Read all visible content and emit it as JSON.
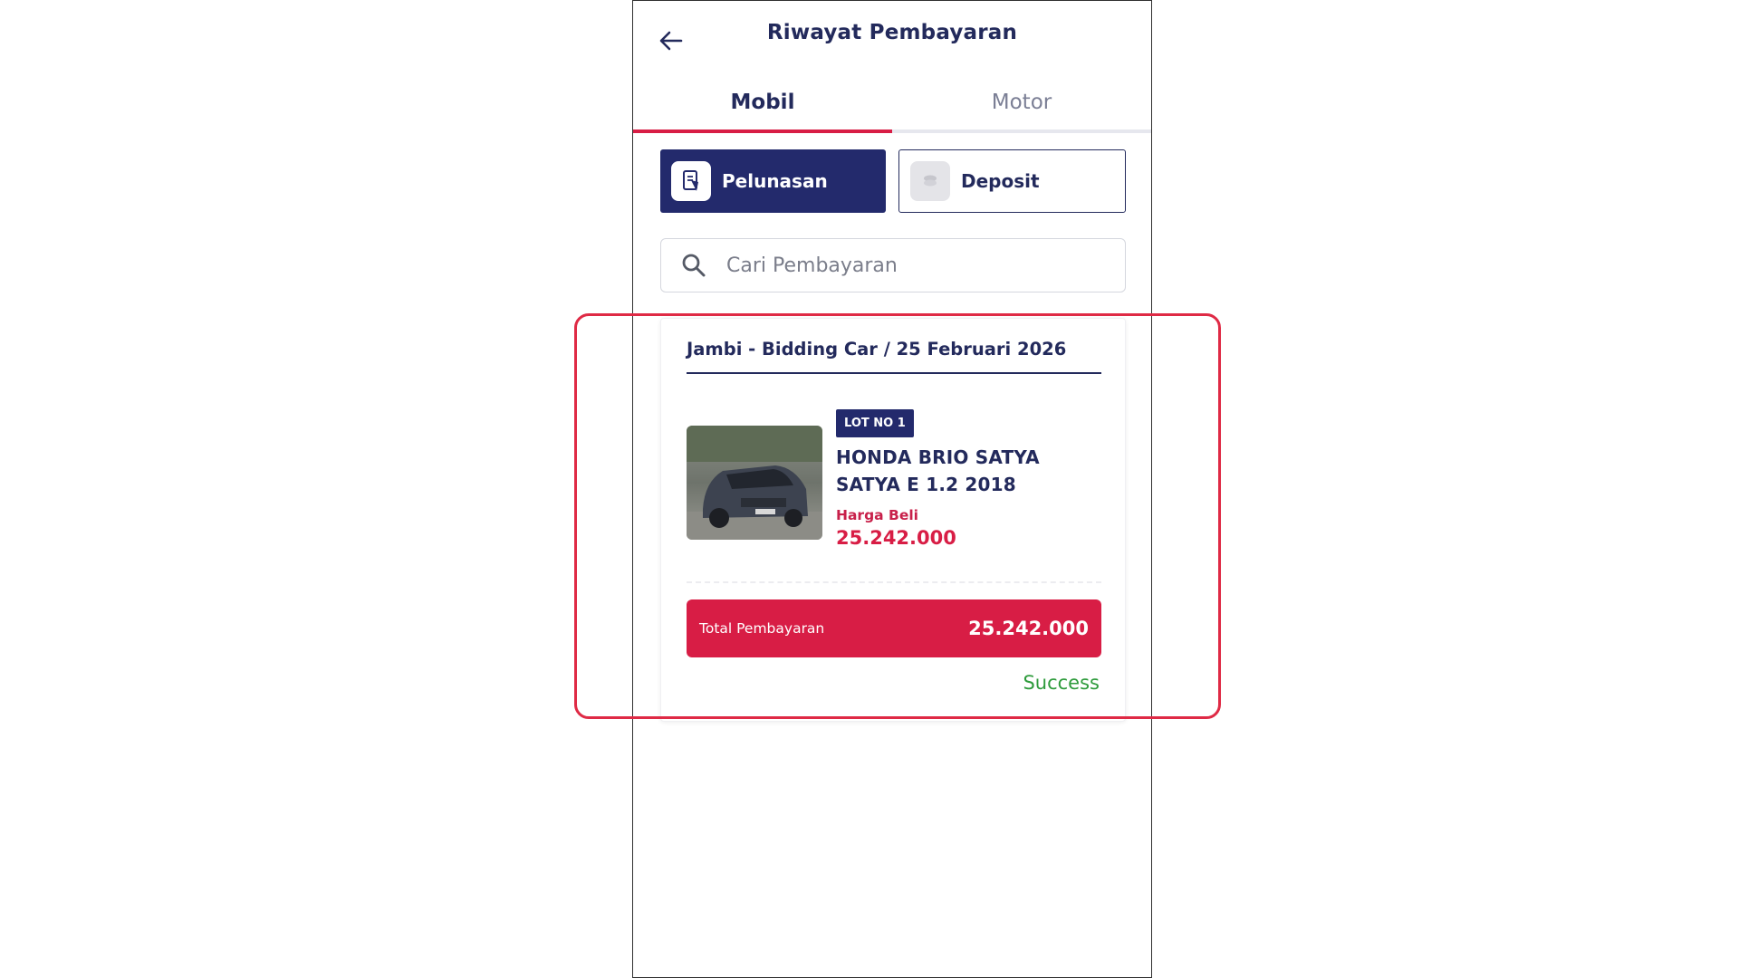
{
  "header": {
    "title": "Riwayat Pembayaran"
  },
  "tabs": [
    {
      "label": "Mobil",
      "active": true
    },
    {
      "label": "Motor",
      "active": false
    }
  ],
  "filters": [
    {
      "label": "Pelunasan",
      "active": true,
      "icon": "document-payment-icon"
    },
    {
      "label": "Deposit",
      "active": false,
      "icon": "coins-icon"
    }
  ],
  "search": {
    "placeholder": "Cari Pembayaran",
    "value": ""
  },
  "payment_card": {
    "header": "Jambi - Bidding Car / 25 Februari 2026",
    "lot_badge": "LOT NO 1",
    "car_name": "HONDA BRIO SATYA SATYA E 1.2 2018",
    "price_label": "Harga Beli",
    "price_value": "25.242.000",
    "total_label": "Total Pembayaran",
    "total_value": "25.242.000",
    "status": "Success"
  },
  "colors": {
    "primary_navy": "#232a6c",
    "accent_red": "#d81d45",
    "success_green": "#2e9b3c",
    "highlight_red": "#df2a45"
  }
}
